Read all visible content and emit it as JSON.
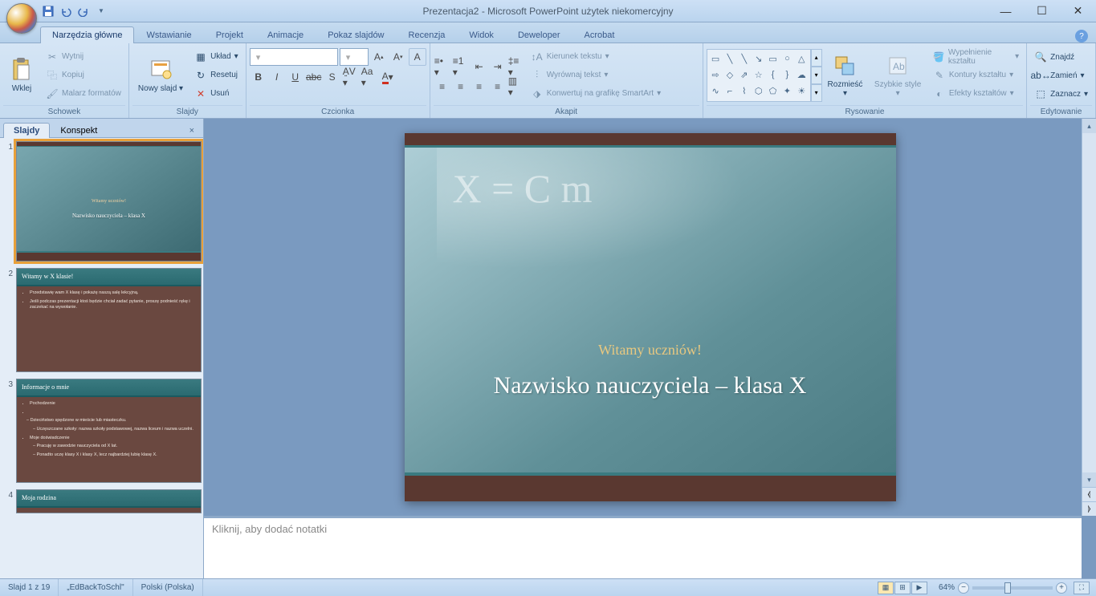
{
  "title": "Prezentacja2 - Microsoft PowerPoint użytek niekomercyjny",
  "tabs": [
    "Narzędzia główne",
    "Wstawianie",
    "Projekt",
    "Animacje",
    "Pokaz slajdów",
    "Recenzja",
    "Widok",
    "Deweloper",
    "Acrobat"
  ],
  "active_tab": 0,
  "ribbon": {
    "clipboard": {
      "label": "Schowek",
      "paste": "Wklej",
      "cut": "Wytnij",
      "copy": "Kopiuj",
      "format_painter": "Malarz formatów"
    },
    "slides": {
      "label": "Slajdy",
      "new_slide": "Nowy slajd",
      "layout": "Układ",
      "reset": "Resetuj",
      "delete": "Usuń"
    },
    "font": {
      "label": "Czcionka"
    },
    "paragraph": {
      "label": "Akapit",
      "text_direction": "Kierunek tekstu",
      "align_text": "Wyrównaj tekst",
      "smartart": "Konwertuj na grafikę SmartArt"
    },
    "drawing": {
      "label": "Rysowanie",
      "arrange": "Rozmieść",
      "quick_styles": "Szybkie style",
      "shape_fill": "Wypełnienie kształtu",
      "shape_outline": "Kontury kształtu",
      "shape_effects": "Efekty kształtów"
    },
    "editing": {
      "label": "Edytowanie",
      "find": "Znajdź",
      "replace": "Zamień",
      "select": "Zaznacz"
    }
  },
  "panel_tabs": [
    "Slajdy",
    "Konspekt"
  ],
  "slides_list": [
    {
      "n": "1",
      "type": "title",
      "subtitle": "Witamy uczniów!",
      "title": "Nazwisko nauczyciela – klasa X"
    },
    {
      "n": "2",
      "type": "content",
      "title": "Witamy w X klasie!",
      "bullets": [
        "Przedstawię wam X klasę i pokażę naszą salę lekcyjną.",
        "Jeśli podczas prezentacji ktoś będzie chciał zadać pytanie, proszę podnieść rękę i zaczekać na wywołanie."
      ]
    },
    {
      "n": "3",
      "type": "content",
      "title": "Informacje o mnie",
      "bullets": [
        "Pochodzenie",
        "– Dzieciństwo spędzone w mieście lub miasteczku.",
        "– Uczęszczane szkoły: nazwa szkoły podstawowej, nazwa liceum i nazwa uczelni.",
        "Moje doświadczenie",
        "– Pracuję w zawodzie nauczyciela od X lat.",
        "– Ponadto uczę klasy X i klasy X, lecz najbardziej lubię klasę X."
      ]
    },
    {
      "n": "4",
      "type": "content",
      "title": "Moja rodzina",
      "bullets": []
    }
  ],
  "main_slide": {
    "subtitle": "Witamy uczniów!",
    "title": "Nazwisko nauczyciela – klasa X"
  },
  "notes_placeholder": "Kliknij, aby dodać notatki",
  "status": {
    "slide_pos": "Slajd 1 z 19",
    "theme": "„EdBackToSchl\"",
    "language": "Polski (Polska)",
    "zoom": "64%"
  }
}
